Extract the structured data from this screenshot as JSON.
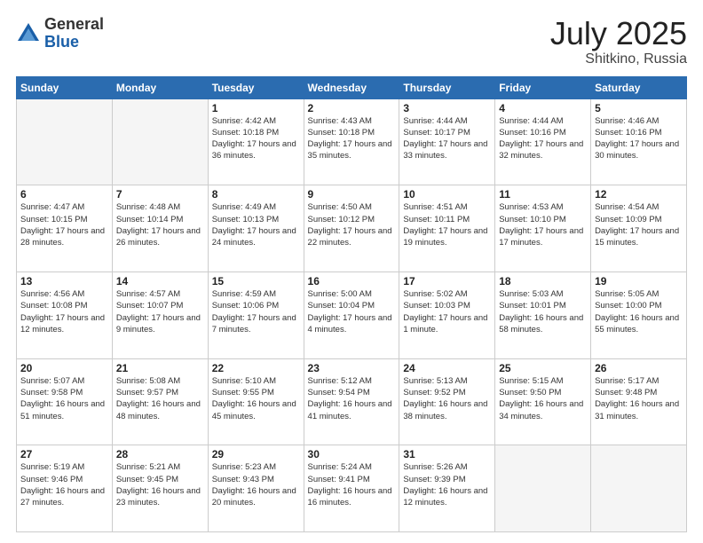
{
  "logo": {
    "general": "General",
    "blue": "Blue"
  },
  "title": {
    "month": "July 2025",
    "location": "Shitkino, Russia"
  },
  "headers": [
    "Sunday",
    "Monday",
    "Tuesday",
    "Wednesday",
    "Thursday",
    "Friday",
    "Saturday"
  ],
  "weeks": [
    [
      {
        "day": "",
        "info": ""
      },
      {
        "day": "",
        "info": ""
      },
      {
        "day": "1",
        "info": "Sunrise: 4:42 AM\nSunset: 10:18 PM\nDaylight: 17 hours\nand 36 minutes."
      },
      {
        "day": "2",
        "info": "Sunrise: 4:43 AM\nSunset: 10:18 PM\nDaylight: 17 hours\nand 35 minutes."
      },
      {
        "day": "3",
        "info": "Sunrise: 4:44 AM\nSunset: 10:17 PM\nDaylight: 17 hours\nand 33 minutes."
      },
      {
        "day": "4",
        "info": "Sunrise: 4:44 AM\nSunset: 10:16 PM\nDaylight: 17 hours\nand 32 minutes."
      },
      {
        "day": "5",
        "info": "Sunrise: 4:46 AM\nSunset: 10:16 PM\nDaylight: 17 hours\nand 30 minutes."
      }
    ],
    [
      {
        "day": "6",
        "info": "Sunrise: 4:47 AM\nSunset: 10:15 PM\nDaylight: 17 hours\nand 28 minutes."
      },
      {
        "day": "7",
        "info": "Sunrise: 4:48 AM\nSunset: 10:14 PM\nDaylight: 17 hours\nand 26 minutes."
      },
      {
        "day": "8",
        "info": "Sunrise: 4:49 AM\nSunset: 10:13 PM\nDaylight: 17 hours\nand 24 minutes."
      },
      {
        "day": "9",
        "info": "Sunrise: 4:50 AM\nSunset: 10:12 PM\nDaylight: 17 hours\nand 22 minutes."
      },
      {
        "day": "10",
        "info": "Sunrise: 4:51 AM\nSunset: 10:11 PM\nDaylight: 17 hours\nand 19 minutes."
      },
      {
        "day": "11",
        "info": "Sunrise: 4:53 AM\nSunset: 10:10 PM\nDaylight: 17 hours\nand 17 minutes."
      },
      {
        "day": "12",
        "info": "Sunrise: 4:54 AM\nSunset: 10:09 PM\nDaylight: 17 hours\nand 15 minutes."
      }
    ],
    [
      {
        "day": "13",
        "info": "Sunrise: 4:56 AM\nSunset: 10:08 PM\nDaylight: 17 hours\nand 12 minutes."
      },
      {
        "day": "14",
        "info": "Sunrise: 4:57 AM\nSunset: 10:07 PM\nDaylight: 17 hours\nand 9 minutes."
      },
      {
        "day": "15",
        "info": "Sunrise: 4:59 AM\nSunset: 10:06 PM\nDaylight: 17 hours\nand 7 minutes."
      },
      {
        "day": "16",
        "info": "Sunrise: 5:00 AM\nSunset: 10:04 PM\nDaylight: 17 hours\nand 4 minutes."
      },
      {
        "day": "17",
        "info": "Sunrise: 5:02 AM\nSunset: 10:03 PM\nDaylight: 17 hours\nand 1 minute."
      },
      {
        "day": "18",
        "info": "Sunrise: 5:03 AM\nSunset: 10:01 PM\nDaylight: 16 hours\nand 58 minutes."
      },
      {
        "day": "19",
        "info": "Sunrise: 5:05 AM\nSunset: 10:00 PM\nDaylight: 16 hours\nand 55 minutes."
      }
    ],
    [
      {
        "day": "20",
        "info": "Sunrise: 5:07 AM\nSunset: 9:58 PM\nDaylight: 16 hours\nand 51 minutes."
      },
      {
        "day": "21",
        "info": "Sunrise: 5:08 AM\nSunset: 9:57 PM\nDaylight: 16 hours\nand 48 minutes."
      },
      {
        "day": "22",
        "info": "Sunrise: 5:10 AM\nSunset: 9:55 PM\nDaylight: 16 hours\nand 45 minutes."
      },
      {
        "day": "23",
        "info": "Sunrise: 5:12 AM\nSunset: 9:54 PM\nDaylight: 16 hours\nand 41 minutes."
      },
      {
        "day": "24",
        "info": "Sunrise: 5:13 AM\nSunset: 9:52 PM\nDaylight: 16 hours\nand 38 minutes."
      },
      {
        "day": "25",
        "info": "Sunrise: 5:15 AM\nSunset: 9:50 PM\nDaylight: 16 hours\nand 34 minutes."
      },
      {
        "day": "26",
        "info": "Sunrise: 5:17 AM\nSunset: 9:48 PM\nDaylight: 16 hours\nand 31 minutes."
      }
    ],
    [
      {
        "day": "27",
        "info": "Sunrise: 5:19 AM\nSunset: 9:46 PM\nDaylight: 16 hours\nand 27 minutes."
      },
      {
        "day": "28",
        "info": "Sunrise: 5:21 AM\nSunset: 9:45 PM\nDaylight: 16 hours\nand 23 minutes."
      },
      {
        "day": "29",
        "info": "Sunrise: 5:23 AM\nSunset: 9:43 PM\nDaylight: 16 hours\nand 20 minutes."
      },
      {
        "day": "30",
        "info": "Sunrise: 5:24 AM\nSunset: 9:41 PM\nDaylight: 16 hours\nand 16 minutes."
      },
      {
        "day": "31",
        "info": "Sunrise: 5:26 AM\nSunset: 9:39 PM\nDaylight: 16 hours\nand 12 minutes."
      },
      {
        "day": "",
        "info": ""
      },
      {
        "day": "",
        "info": ""
      }
    ]
  ]
}
